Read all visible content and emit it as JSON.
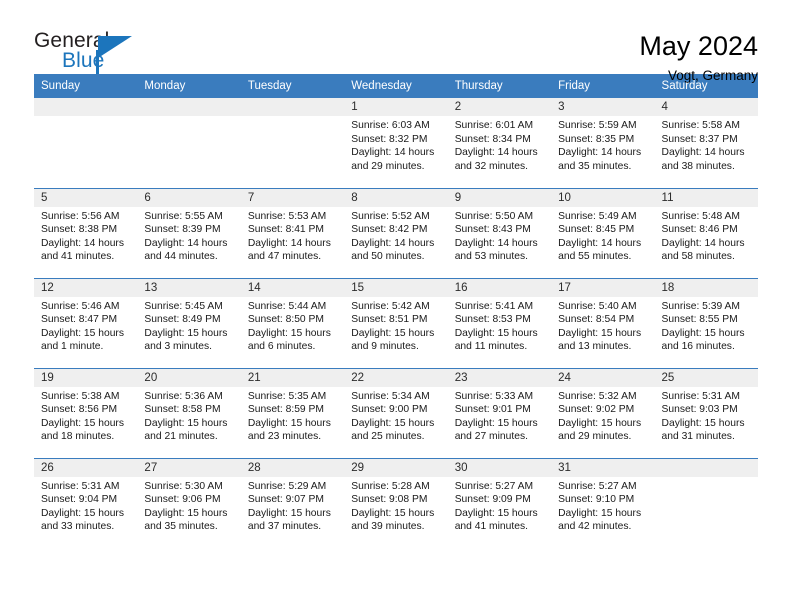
{
  "brand": {
    "name_top": "General",
    "name_bottom": "Blue",
    "accent_color": "#1c75bc"
  },
  "header": {
    "title": "May 2024",
    "location": "Vogt, Germany"
  },
  "theme": {
    "header_blue": "#3a7cbe",
    "daynum_gray": "#efefef"
  },
  "weekday_headers": [
    "Sunday",
    "Monday",
    "Tuesday",
    "Wednesday",
    "Thursday",
    "Friday",
    "Saturday"
  ],
  "labels": {
    "sunrise": "Sunrise:",
    "sunset": "Sunset:",
    "daylight": "Daylight:"
  },
  "weeks": [
    [
      {
        "day": "",
        "blank": true
      },
      {
        "day": "",
        "blank": true
      },
      {
        "day": "",
        "blank": true
      },
      {
        "day": "1",
        "sunrise": "Sunrise: 6:03 AM",
        "sunset": "Sunset: 8:32 PM",
        "daylight1": "Daylight: 14 hours",
        "daylight2": "and 29 minutes."
      },
      {
        "day": "2",
        "sunrise": "Sunrise: 6:01 AM",
        "sunset": "Sunset: 8:34 PM",
        "daylight1": "Daylight: 14 hours",
        "daylight2": "and 32 minutes."
      },
      {
        "day": "3",
        "sunrise": "Sunrise: 5:59 AM",
        "sunset": "Sunset: 8:35 PM",
        "daylight1": "Daylight: 14 hours",
        "daylight2": "and 35 minutes."
      },
      {
        "day": "4",
        "sunrise": "Sunrise: 5:58 AM",
        "sunset": "Sunset: 8:37 PM",
        "daylight1": "Daylight: 14 hours",
        "daylight2": "and 38 minutes."
      }
    ],
    [
      {
        "day": "5",
        "sunrise": "Sunrise: 5:56 AM",
        "sunset": "Sunset: 8:38 PM",
        "daylight1": "Daylight: 14 hours",
        "daylight2": "and 41 minutes."
      },
      {
        "day": "6",
        "sunrise": "Sunrise: 5:55 AM",
        "sunset": "Sunset: 8:39 PM",
        "daylight1": "Daylight: 14 hours",
        "daylight2": "and 44 minutes."
      },
      {
        "day": "7",
        "sunrise": "Sunrise: 5:53 AM",
        "sunset": "Sunset: 8:41 PM",
        "daylight1": "Daylight: 14 hours",
        "daylight2": "and 47 minutes."
      },
      {
        "day": "8",
        "sunrise": "Sunrise: 5:52 AM",
        "sunset": "Sunset: 8:42 PM",
        "daylight1": "Daylight: 14 hours",
        "daylight2": "and 50 minutes."
      },
      {
        "day": "9",
        "sunrise": "Sunrise: 5:50 AM",
        "sunset": "Sunset: 8:43 PM",
        "daylight1": "Daylight: 14 hours",
        "daylight2": "and 53 minutes."
      },
      {
        "day": "10",
        "sunrise": "Sunrise: 5:49 AM",
        "sunset": "Sunset: 8:45 PM",
        "daylight1": "Daylight: 14 hours",
        "daylight2": "and 55 minutes."
      },
      {
        "day": "11",
        "sunrise": "Sunrise: 5:48 AM",
        "sunset": "Sunset: 8:46 PM",
        "daylight1": "Daylight: 14 hours",
        "daylight2": "and 58 minutes."
      }
    ],
    [
      {
        "day": "12",
        "sunrise": "Sunrise: 5:46 AM",
        "sunset": "Sunset: 8:47 PM",
        "daylight1": "Daylight: 15 hours",
        "daylight2": "and 1 minute."
      },
      {
        "day": "13",
        "sunrise": "Sunrise: 5:45 AM",
        "sunset": "Sunset: 8:49 PM",
        "daylight1": "Daylight: 15 hours",
        "daylight2": "and 3 minutes."
      },
      {
        "day": "14",
        "sunrise": "Sunrise: 5:44 AM",
        "sunset": "Sunset: 8:50 PM",
        "daylight1": "Daylight: 15 hours",
        "daylight2": "and 6 minutes."
      },
      {
        "day": "15",
        "sunrise": "Sunrise: 5:42 AM",
        "sunset": "Sunset: 8:51 PM",
        "daylight1": "Daylight: 15 hours",
        "daylight2": "and 9 minutes."
      },
      {
        "day": "16",
        "sunrise": "Sunrise: 5:41 AM",
        "sunset": "Sunset: 8:53 PM",
        "daylight1": "Daylight: 15 hours",
        "daylight2": "and 11 minutes."
      },
      {
        "day": "17",
        "sunrise": "Sunrise: 5:40 AM",
        "sunset": "Sunset: 8:54 PM",
        "daylight1": "Daylight: 15 hours",
        "daylight2": "and 13 minutes."
      },
      {
        "day": "18",
        "sunrise": "Sunrise: 5:39 AM",
        "sunset": "Sunset: 8:55 PM",
        "daylight1": "Daylight: 15 hours",
        "daylight2": "and 16 minutes."
      }
    ],
    [
      {
        "day": "19",
        "sunrise": "Sunrise: 5:38 AM",
        "sunset": "Sunset: 8:56 PM",
        "daylight1": "Daylight: 15 hours",
        "daylight2": "and 18 minutes."
      },
      {
        "day": "20",
        "sunrise": "Sunrise: 5:36 AM",
        "sunset": "Sunset: 8:58 PM",
        "daylight1": "Daylight: 15 hours",
        "daylight2": "and 21 minutes."
      },
      {
        "day": "21",
        "sunrise": "Sunrise: 5:35 AM",
        "sunset": "Sunset: 8:59 PM",
        "daylight1": "Daylight: 15 hours",
        "daylight2": "and 23 minutes."
      },
      {
        "day": "22",
        "sunrise": "Sunrise: 5:34 AM",
        "sunset": "Sunset: 9:00 PM",
        "daylight1": "Daylight: 15 hours",
        "daylight2": "and 25 minutes."
      },
      {
        "day": "23",
        "sunrise": "Sunrise: 5:33 AM",
        "sunset": "Sunset: 9:01 PM",
        "daylight1": "Daylight: 15 hours",
        "daylight2": "and 27 minutes."
      },
      {
        "day": "24",
        "sunrise": "Sunrise: 5:32 AM",
        "sunset": "Sunset: 9:02 PM",
        "daylight1": "Daylight: 15 hours",
        "daylight2": "and 29 minutes."
      },
      {
        "day": "25",
        "sunrise": "Sunrise: 5:31 AM",
        "sunset": "Sunset: 9:03 PM",
        "daylight1": "Daylight: 15 hours",
        "daylight2": "and 31 minutes."
      }
    ],
    [
      {
        "day": "26",
        "sunrise": "Sunrise: 5:31 AM",
        "sunset": "Sunset: 9:04 PM",
        "daylight1": "Daylight: 15 hours",
        "daylight2": "and 33 minutes."
      },
      {
        "day": "27",
        "sunrise": "Sunrise: 5:30 AM",
        "sunset": "Sunset: 9:06 PM",
        "daylight1": "Daylight: 15 hours",
        "daylight2": "and 35 minutes."
      },
      {
        "day": "28",
        "sunrise": "Sunrise: 5:29 AM",
        "sunset": "Sunset: 9:07 PM",
        "daylight1": "Daylight: 15 hours",
        "daylight2": "and 37 minutes."
      },
      {
        "day": "29",
        "sunrise": "Sunrise: 5:28 AM",
        "sunset": "Sunset: 9:08 PM",
        "daylight1": "Daylight: 15 hours",
        "daylight2": "and 39 minutes."
      },
      {
        "day": "30",
        "sunrise": "Sunrise: 5:27 AM",
        "sunset": "Sunset: 9:09 PM",
        "daylight1": "Daylight: 15 hours",
        "daylight2": "and 41 minutes."
      },
      {
        "day": "31",
        "sunrise": "Sunrise: 5:27 AM",
        "sunset": "Sunset: 9:10 PM",
        "daylight1": "Daylight: 15 hours",
        "daylight2": "and 42 minutes."
      },
      {
        "day": "",
        "blank": true
      }
    ]
  ]
}
